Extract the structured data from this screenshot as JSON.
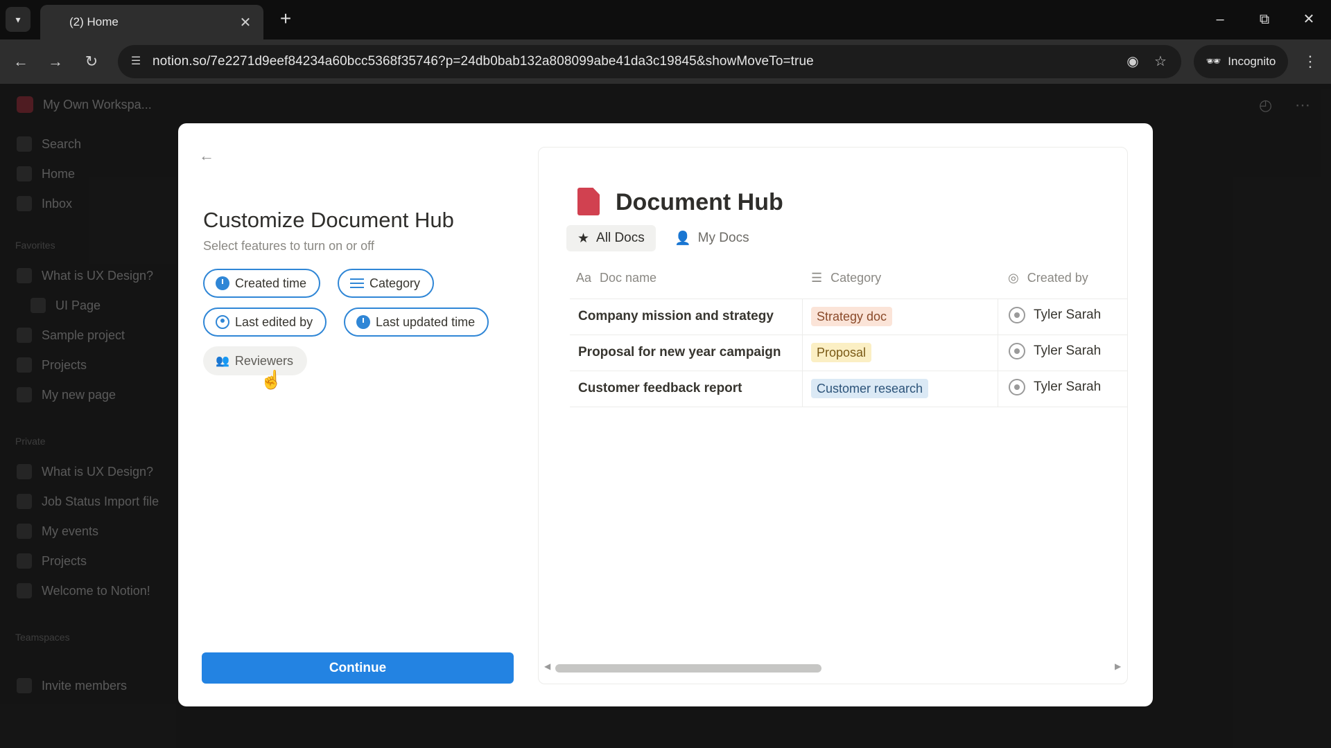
{
  "browser": {
    "tab_title": "(2) Home",
    "url": "notion.so/7e2271d9eef84234a60bcc5368f35746?p=24db0bab132a808099abe41da3c19845&showMoveTo=true",
    "incognito_label": "Incognito"
  },
  "sidebar": {
    "workspace": "My Own Workspa...",
    "items": [
      {
        "label": "Search"
      },
      {
        "label": "Home"
      },
      {
        "label": "Inbox"
      }
    ],
    "sections": {
      "favorites": "Favorites",
      "private": "Private",
      "teamspaces": "Teamspaces"
    },
    "favorites": [
      {
        "label": "What is UX Design?"
      },
      {
        "label": "UI Page"
      },
      {
        "label": "Sample project"
      },
      {
        "label": "Projects"
      },
      {
        "label": "My new page"
      }
    ],
    "private": [
      {
        "label": "What is UX Design?"
      },
      {
        "label": "Job Status Import file"
      },
      {
        "label": "My events"
      },
      {
        "label": "Projects"
      },
      {
        "label": "Welcome to Notion!"
      }
    ],
    "invite": "Invite members"
  },
  "modal": {
    "title": "Customize Document Hub",
    "subtitle": "Select features to turn on or off",
    "chips": [
      {
        "label": "Created time",
        "on": true
      },
      {
        "label": "Category",
        "on": true
      },
      {
        "label": "Last edited by",
        "on": true
      },
      {
        "label": "Last updated time",
        "on": true
      },
      {
        "label": "Reviewers",
        "on": false
      }
    ],
    "continue_label": "Continue",
    "accent": "#2383e2",
    "preview": {
      "title": "Document Hub",
      "tabs": [
        {
          "label": "All Docs",
          "active": true
        },
        {
          "label": "My Docs",
          "active": false
        }
      ],
      "columns": [
        {
          "label": "Doc name",
          "icon": "Aa"
        },
        {
          "label": "Category"
        },
        {
          "label": "Created by"
        }
      ],
      "rows": [
        {
          "name": "Company mission and strategy",
          "category": "Strategy doc",
          "category_bg": "#fbe4d8",
          "category_fg": "#8a4a2a",
          "created_by": "Tyler Sarah"
        },
        {
          "name": "Proposal for new year campaign",
          "category": "Proposal",
          "category_bg": "#fbefc4",
          "category_fg": "#7a5a16",
          "created_by": "Tyler Sarah"
        },
        {
          "name": "Customer feedback report",
          "category": "Customer research",
          "category_bg": "#dbe9f5",
          "category_fg": "#2c5379",
          "created_by": "Tyler Sarah"
        }
      ]
    }
  }
}
